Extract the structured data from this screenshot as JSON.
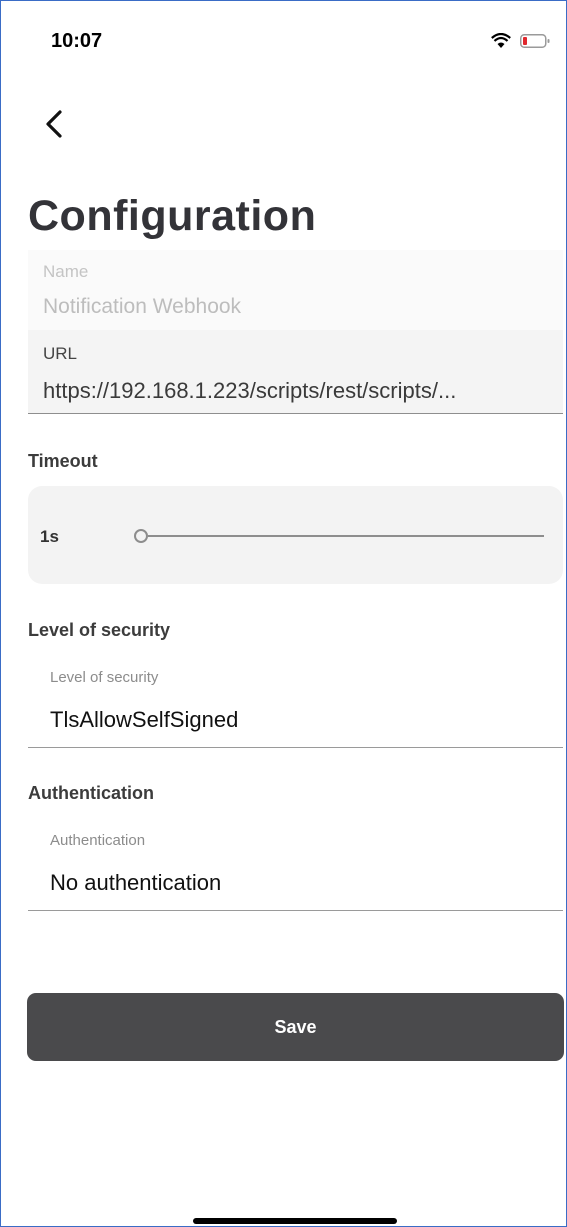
{
  "status_bar": {
    "time": "10:07"
  },
  "header": {
    "title": "Configuration"
  },
  "name_field": {
    "label": "Name",
    "value": "Notification Webhook"
  },
  "url_field": {
    "label": "URL",
    "value": "https://192.168.1.223/scripts/rest/scripts/..."
  },
  "timeout": {
    "section_label": "Timeout",
    "value_label": "1s",
    "level": 0
  },
  "security": {
    "section_label": "Level of security",
    "field_label": "Level of security",
    "value": "TlsAllowSelfSigned"
  },
  "authentication": {
    "section_label": "Authentication",
    "field_label": "Authentication",
    "value": "No authentication"
  },
  "actions": {
    "save_label": "Save"
  },
  "colors": {
    "primary_button": "#4a4a4c",
    "battery_low": "#e0282e"
  }
}
